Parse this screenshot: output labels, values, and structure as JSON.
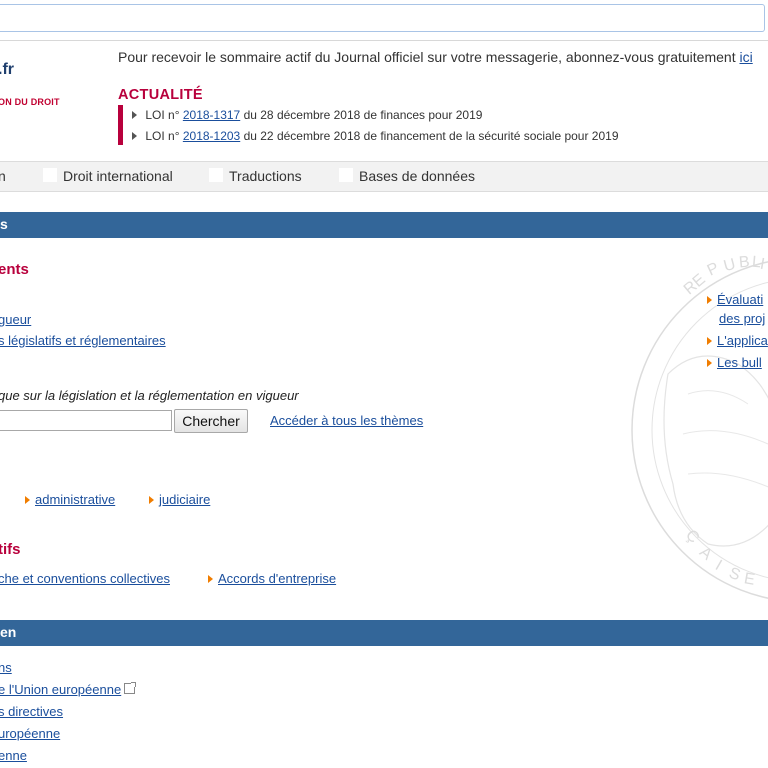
{
  "header": {
    "logo_suffix": ".fr",
    "logo_subtitle": "ON DU DROIT",
    "subscribe_text": "Pour recevoir le sommaire actif du Journal officiel sur votre messagerie, abonnez-vous gratuitement",
    "subscribe_link": "ici",
    "actualite_title": "ACTUALITÉ",
    "actualite_items": [
      {
        "prefix": "LOI n°",
        "number": "2018-1317",
        "rest": "du 28 décembre 2018 de finances pour 2019"
      },
      {
        "prefix": "LOI n°",
        "number": "2018-1203",
        "rest": "du 22 décembre 2018 de financement de la sécurité sociale pour 2019"
      }
    ]
  },
  "nav": {
    "items": [
      "n",
      "Droit international",
      "Traductions",
      "Bases de données"
    ]
  },
  "sections": {
    "bar1_title": "s",
    "bar2_title": "en"
  },
  "documents": {
    "heading": "ents",
    "links": [
      "gueur",
      "s législatifs et réglementaires"
    ],
    "search_label": "que sur la législation et la réglementation en vigueur",
    "search_value": "",
    "search_button": "Chercher",
    "all_themes_link": "Accéder à tous les thèmes"
  },
  "jurisprudence": {
    "links": [
      "administrative",
      "judiciaire"
    ]
  },
  "conventions": {
    "heading": "tifs",
    "links": [
      "che et conventions collectives",
      "Accords d'entreprise"
    ]
  },
  "right_links": [
    "Évaluati",
    "des proj",
    "L'applica",
    "Les bull"
  ],
  "seal_letters": [
    "RE",
    "P",
    "U",
    "B",
    "L",
    "I",
    "Ç",
    "A",
    "I",
    "S",
    "E"
  ],
  "eu_links": [
    "ns",
    "e l'Union européenne",
    "s directives",
    "uropéenne",
    "enne"
  ],
  "colors": {
    "accent_red": "#b8003c",
    "bar_blue": "#336699",
    "link_blue": "#1a4e9c",
    "bullet_orange": "#f07d00"
  }
}
